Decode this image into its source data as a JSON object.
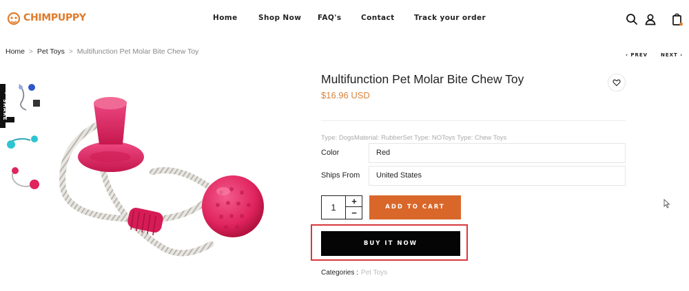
{
  "brand": {
    "name": "CHIMPUPPY",
    "color": "#e07b2a"
  },
  "nav": {
    "home": "Home",
    "shop": "Shop Now",
    "faqs": "FAQ's",
    "contact": "Contact",
    "track": "Track your order"
  },
  "header_icons": [
    "search-icon",
    "user-icon",
    "cart-icon"
  ],
  "breadcrumb": {
    "home": "Home",
    "sep": ">",
    "category": "Pet Toys",
    "current": "Multifunction Pet Molar Bite Chew Toy"
  },
  "pager": {
    "prev": "PREV",
    "next": "NEXT"
  },
  "share": {
    "label": "SHARE"
  },
  "product": {
    "title": "Multifunction Pet Molar Bite Chew Toy",
    "price": "$16.96 USD",
    "type_line": "Type: DogsMaterial: RubberSet Type: NOToys Type: Chew Toys",
    "options": {
      "color_label": "Color",
      "color_value": "Red",
      "ships_label": "Ships From",
      "ships_value": "United States"
    },
    "quantity": "1",
    "add_to_cart": "ADD TO CART",
    "buy_now": "BUY IT NOW",
    "categories_label": "Categories :",
    "categories_value": "Pet Toys"
  },
  "colors": {
    "accent_orange": "#d9672a",
    "price": "#d9823b",
    "buy_button": "#050505",
    "highlight_border": "#d9373d",
    "toy_pink": "#e0245e"
  }
}
